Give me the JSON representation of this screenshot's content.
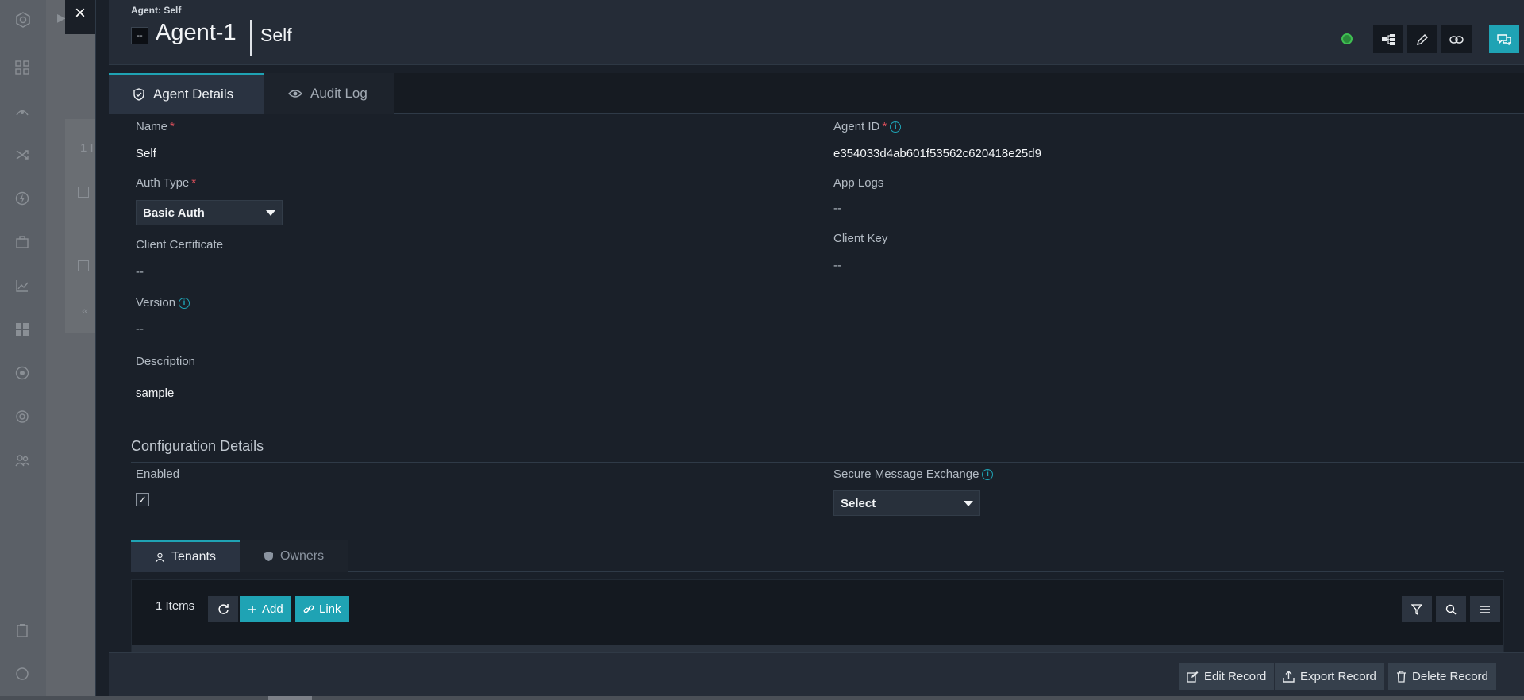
{
  "colors": {
    "accent": "#1fa3b4",
    "required": "#e0505c",
    "status": "#3fbf52"
  },
  "background": {
    "list_text": "1 I"
  },
  "close_label": "×",
  "header": {
    "breadcrumb": "Agent: Self",
    "title_icon_text": "--",
    "title": "Agent-1",
    "subtitle": "Self"
  },
  "tabs": [
    {
      "label": "Agent Details",
      "icon": "shield-icon"
    },
    {
      "label": "Audit Log",
      "icon": "eye-icon"
    }
  ],
  "fields": {
    "name": {
      "label": "Name",
      "required": "*",
      "value": "Self"
    },
    "agent_id": {
      "label": "Agent ID",
      "required": "*",
      "value": "e354033d4ab601f53562c620418e25d9"
    },
    "auth_type": {
      "label": "Auth Type",
      "required": "*",
      "value": "Basic Auth"
    },
    "app_logs": {
      "label": "App Logs",
      "value": "--"
    },
    "client_certificate": {
      "label": "Client Certificate",
      "value": "--"
    },
    "client_key": {
      "label": "Client Key",
      "value": "--"
    },
    "version": {
      "label": "Version",
      "value": "--"
    },
    "description": {
      "label": "Description",
      "value": "sample"
    }
  },
  "configuration": {
    "title": "Configuration Details",
    "enabled": {
      "label": "Enabled",
      "checked": "✓"
    },
    "secure_message_exchange": {
      "label": "Secure Message Exchange",
      "value": "Select"
    }
  },
  "subtabs": [
    {
      "label": "Tenants",
      "icon": "user-icon"
    },
    {
      "label": "Owners",
      "icon": "shield-icon"
    }
  ],
  "grid": {
    "items_count": "1 Items",
    "add_label": "Add",
    "link_label": "Link"
  },
  "footer": {
    "edit_label": "Edit Record",
    "export_label": "Export Record",
    "delete_label": "Delete Record"
  },
  "info_glyph": "i"
}
